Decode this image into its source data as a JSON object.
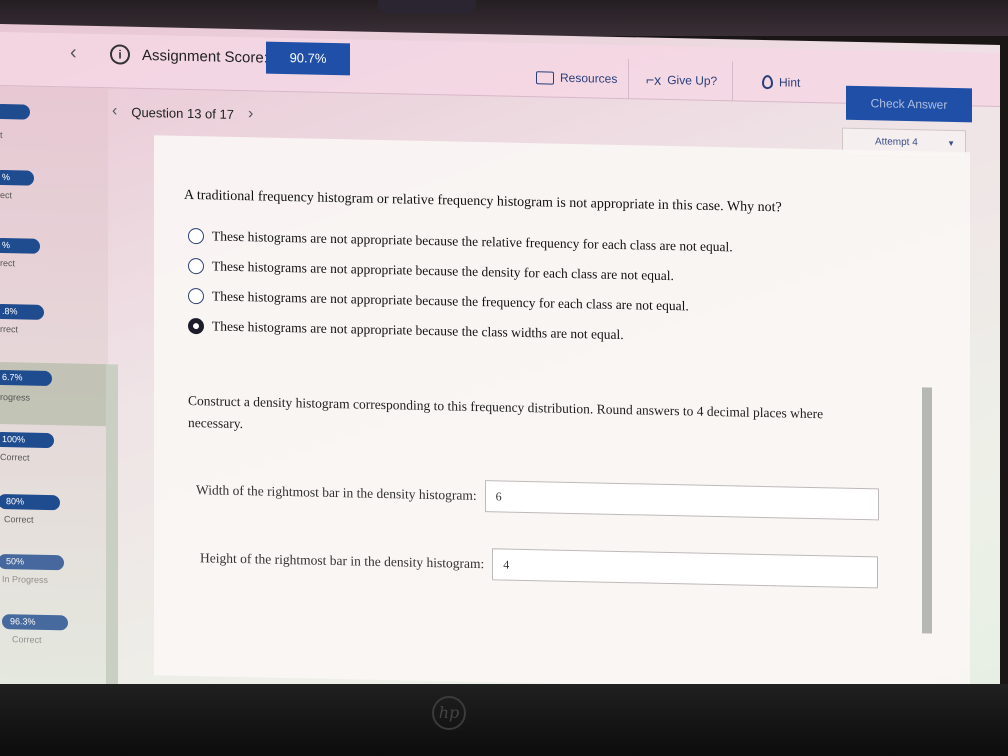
{
  "header": {
    "assignment_score_label": "Assignment Score:",
    "assignment_score_value": "90.7%",
    "resources_label": "Resources",
    "give_up_label": "Give Up?",
    "hint_label": "Hint",
    "check_answer_label": "Check Answer"
  },
  "question_nav": {
    "label": "Question 13 of 17",
    "attempt_label": "Attempt 4"
  },
  "sidebar": {
    "items": [
      {
        "score": "%",
        "status": "ect"
      },
      {
        "score": "%",
        "status": "rect"
      },
      {
        "score": ".8%",
        "status": "rrect"
      },
      {
        "score": "6.7%",
        "status": "rogress"
      },
      {
        "score": "100%",
        "status": "Correct"
      },
      {
        "score": "80%",
        "status": "Correct"
      },
      {
        "score": "50%",
        "status": "In Progress"
      },
      {
        "score": "96.3%",
        "status": "Correct"
      }
    ]
  },
  "question": {
    "prompt": "A traditional frequency histogram or relative frequency histogram is not appropriate in this case. Why not?",
    "choices": [
      {
        "text": "These histograms are not appropriate because the relative frequency for each class are not equal.",
        "selected": false
      },
      {
        "text": "These histograms are not appropriate because the density for each class are not equal.",
        "selected": false
      },
      {
        "text": "These histograms are not appropriate because the frequency for each class are not equal.",
        "selected": false
      },
      {
        "text": "These histograms are not appropriate because the class widths are not equal.",
        "selected": true
      }
    ],
    "instructions": "Construct a density histogram corresponding to this frequency distribution. Round answers to 4 decimal places where necessary.",
    "width_label": "Width of the rightmost bar in the density histogram:",
    "width_value": "6",
    "height_label": "Height of the rightmost bar in the density histogram:",
    "height_value": "4"
  },
  "colors": {
    "primary": "#1f4fa6",
    "sidebar_pill": "#1f4b8f"
  }
}
